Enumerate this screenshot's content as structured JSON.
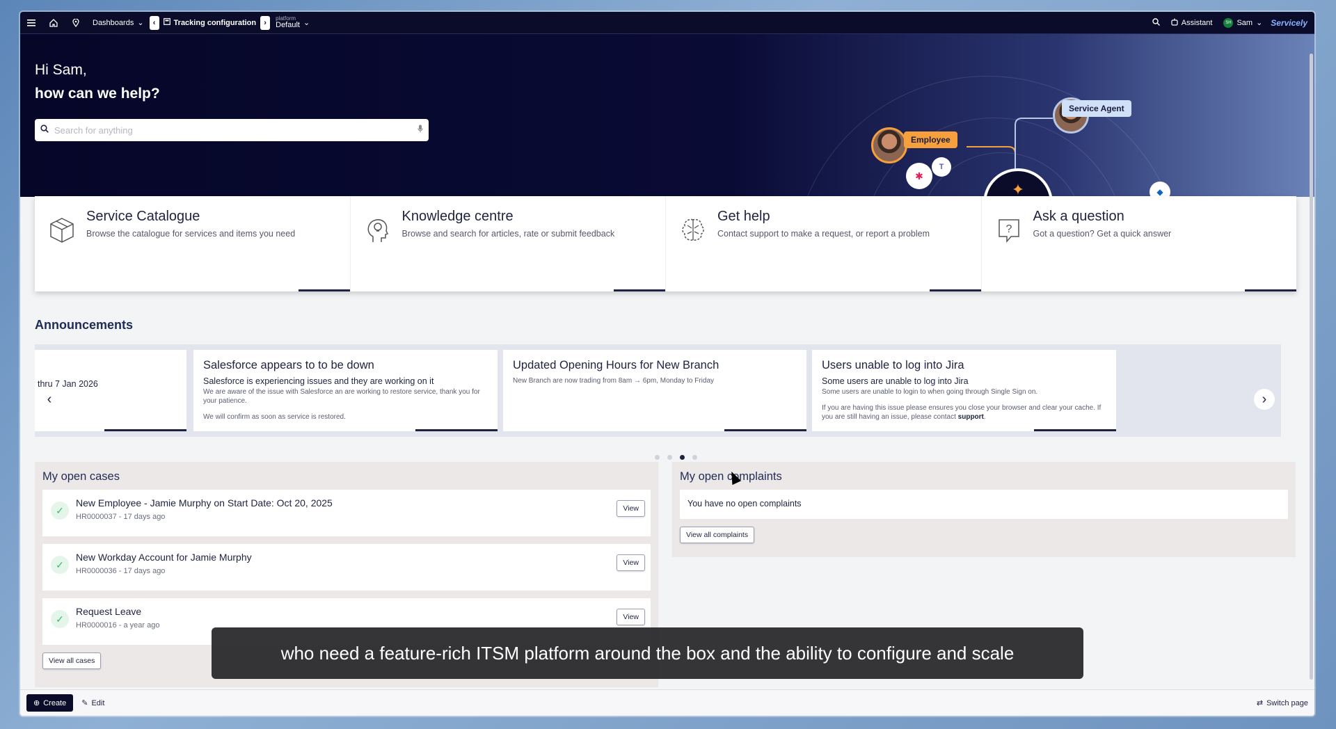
{
  "topbar": {
    "dashboards_label": "Dashboards",
    "tab_label": "Tracking configuration",
    "platform_small": "platform",
    "platform_value": "Default",
    "assistant_label": "Assistant",
    "user_initials": "SH",
    "user_name": "Sam",
    "brand": "Servicely"
  },
  "hero": {
    "greeting": "Hi Sam,",
    "question": "how can we help?",
    "search_placeholder": "Search for anything",
    "employee_label": "Employee",
    "agent_label": "Service Agent"
  },
  "cards": [
    {
      "title": "Service Catalogue",
      "desc": "Browse the catalogue for services and items you need",
      "icon": "box-icon"
    },
    {
      "title": "Knowledge centre",
      "desc": "Browse and search for articles, rate or submit feedback",
      "icon": "head-bulb-icon"
    },
    {
      "title": "Get help",
      "desc": "Contact support to make a request, or report a problem",
      "icon": "brain-icon"
    },
    {
      "title": "Ask a question",
      "desc": "Got a question? Get a quick answer",
      "icon": "question-bubble-icon"
    }
  ],
  "announcements": {
    "title": "Announcements",
    "partial_text": "thru 7 Jan 2026",
    "items": [
      {
        "title": "Salesforce appears to to be down",
        "subtitle": "Salesforce is experiencing issues and they are working on it",
        "body1": "We are aware of the issue with Salesforce an are working to restore service, thank you for your patience.",
        "body2": "We will confirm as soon as service is restored."
      },
      {
        "title": "Updated Opening Hours for New Branch",
        "subtitle": "",
        "body1": "New Branch are now trading from 8am → 6pm, Monday to Friday",
        "body2": ""
      },
      {
        "title": "Users unable to log into Jira",
        "subtitle": "Some users are unable to log into Jira",
        "body1": "Some users are unable to login to when going through Single Sign on.",
        "body2": "If you are having this issue please ensures you close your browser and clear your cache.  If you are still having an issue, please contact",
        "link": "support"
      }
    ],
    "active_dot": 2,
    "dot_count": 4
  },
  "open_cases": {
    "title": "My open cases",
    "view_label": "View",
    "view_all_label": "View all cases",
    "items": [
      {
        "title": "New Employee - Jamie Murphy on Start Date: Oct 20, 2025",
        "meta": "HR0000037 - 17 days ago"
      },
      {
        "title": "New Workday Account for Jamie Murphy",
        "meta": "HR0000036 - 17 days ago"
      },
      {
        "title": "Request Leave",
        "meta": "HR0000016 - a year ago"
      }
    ]
  },
  "complaints": {
    "title": "My open complaints",
    "empty_text": "You have no open complaints",
    "view_all_label": "View all complaints"
  },
  "caption": "who need a feature-rich ITSM platform around the box and the ability to configure and scale",
  "bottombar": {
    "create_label": "Create",
    "edit_label": "Edit",
    "switch_label": "Switch page"
  }
}
